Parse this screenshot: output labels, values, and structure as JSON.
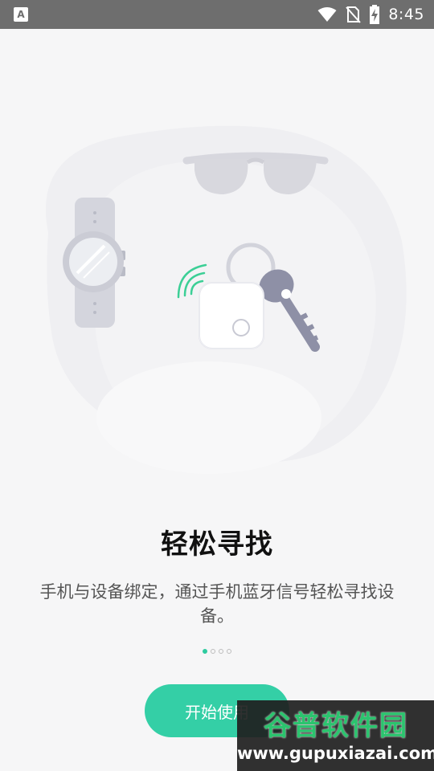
{
  "status_bar": {
    "left_icon_letter": "A",
    "icons": [
      "wifi-icon",
      "no-sim-icon",
      "battery-charging-icon"
    ],
    "time": "8:45"
  },
  "illustration": {
    "items": [
      "sunglasses",
      "smartwatch",
      "bluetooth-tracker",
      "keyring-key",
      "signal-waves"
    ],
    "accent_color": "#3ccf96"
  },
  "onboarding": {
    "title": "轻松寻找",
    "description": "手机与设备绑定，通过手机蓝牙信号轻松寻找设备。",
    "page_count": 4,
    "current_page": 1,
    "start_button_label": "开始使用"
  },
  "watermark": {
    "title": "谷普软件园",
    "url": "www.gupuxiazai.com"
  },
  "colors": {
    "primary": "#34cfa6",
    "status_bar": "#6e6e6e",
    "background": "#f6f6f7"
  }
}
